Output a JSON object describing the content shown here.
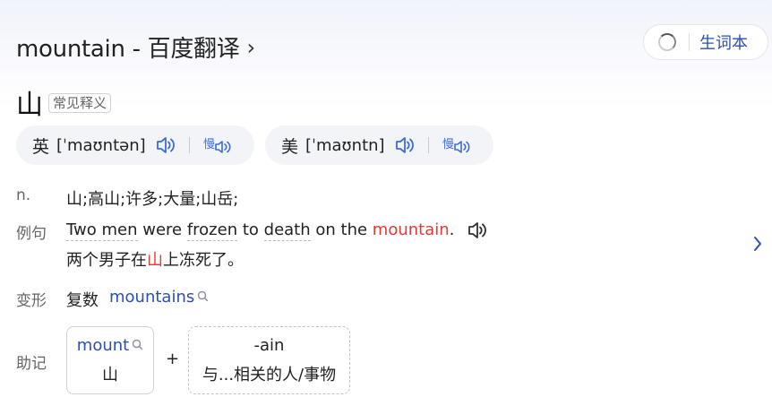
{
  "header": {
    "title": "mountain - 百度翻译",
    "chevron": "›",
    "vocab_label": "生词本"
  },
  "headword": {
    "char": "山",
    "tag": "常见释义"
  },
  "pron": {
    "uk": {
      "lang": "英",
      "ipa": "[ˈmaʊntən]"
    },
    "us": {
      "lang": "美",
      "ipa": "[ˈmaʊntn]"
    }
  },
  "definition": {
    "pos": "n.",
    "text": "山;高山;许多;大量;山岳;"
  },
  "example": {
    "label": "例句",
    "en_parts": [
      "Two men",
      " were ",
      "frozen",
      " to ",
      "death",
      " on the ",
      "mountain",
      "."
    ],
    "cn_pre": "两个男子在",
    "cn_hl": "山",
    "cn_post": "上冻死了。"
  },
  "variant": {
    "label": "变形",
    "type": "复数",
    "word": "mountains"
  },
  "mnemonic": {
    "label": "助记",
    "root_word": "mount",
    "root_meaning": "山",
    "plus": "+",
    "suffix": "-ain",
    "suffix_meaning": "与...相关的人/事物"
  },
  "icons": {
    "speaker": "speaker-icon",
    "slow": "slow-speaker-icon",
    "search": "search-icon",
    "spinner": "loading-spinner-icon",
    "chevron": "chevron-right-icon"
  },
  "colors": {
    "link": "#2b4fb5",
    "highlight": "#e53935",
    "speaker": "#3c6be0"
  }
}
